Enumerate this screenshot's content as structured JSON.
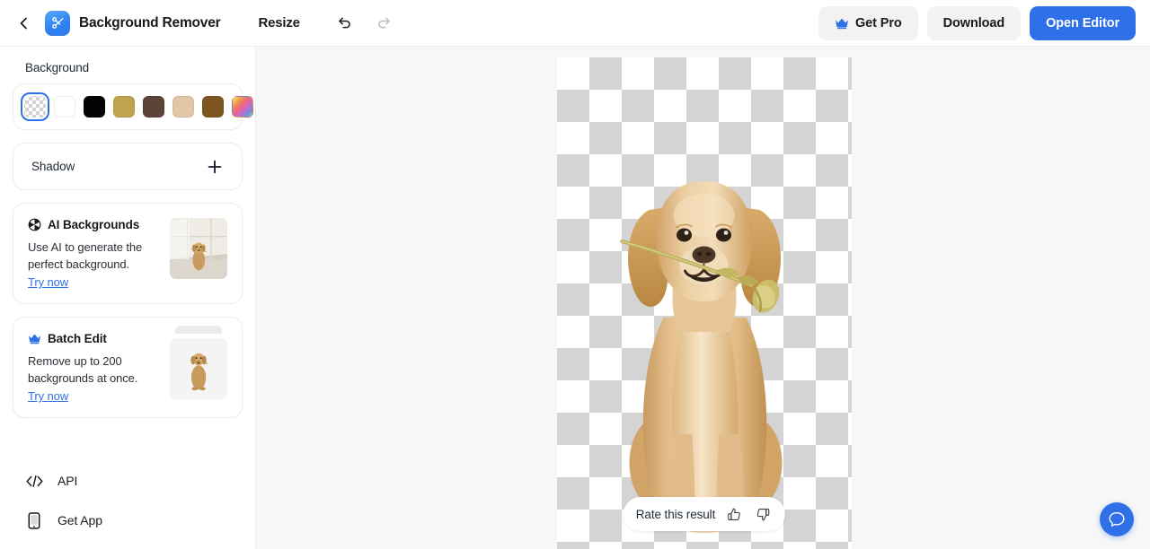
{
  "topbar": {
    "back_icon": "chevron-left-icon",
    "logo_icon": "scissors-icon",
    "title": "Background Remover",
    "resize_label": "Resize",
    "undo_icon": "undo-arrow-icon",
    "redo_icon": "redo-arrow-icon",
    "get_pro_label": "Get Pro",
    "get_pro_icon": "crown-icon",
    "download_label": "Download",
    "open_editor_label": "Open Editor",
    "primary_color": "#2f6fe8",
    "ghost_color": "#f2f2f3"
  },
  "sidebar": {
    "background_section": {
      "title": "Background",
      "swatches": [
        {
          "name": "transparent",
          "color": "transparent",
          "selected": true
        },
        {
          "name": "white",
          "color": "#ffffff",
          "selected": false
        },
        {
          "name": "black",
          "color": "#020202",
          "selected": false
        },
        {
          "name": "khaki",
          "color": "#bfa44f",
          "selected": false
        },
        {
          "name": "dark-brown",
          "color": "#5c4438",
          "selected": false
        },
        {
          "name": "tan",
          "color": "#e2c6a7",
          "selected": false
        },
        {
          "name": "brown",
          "color": "#7d5521",
          "selected": false
        },
        {
          "name": "gradient",
          "color": "rainbow",
          "selected": false
        }
      ]
    },
    "shadow_section": {
      "label": "Shadow",
      "add_icon": "plus-icon"
    },
    "promos": [
      {
        "icon": "sparkle-icon",
        "title": "AI Backgrounds",
        "description": "Use AI to generate the perfect background.",
        "link": "Try now",
        "thumb": "dog-in-room-thumbnail"
      },
      {
        "icon": "crown-icon",
        "title": "Batch Edit",
        "description": "Remove up to 200 backgrounds at once.",
        "link": "Try now",
        "thumb": "stacked-dog-thumbnail"
      }
    ],
    "bottom_links": [
      {
        "icon": "code-icon",
        "label": "API"
      },
      {
        "icon": "phone-icon",
        "label": "Get App"
      }
    ]
  },
  "canvas": {
    "checker_light": "#ffffff",
    "checker_dark": "#d4d4d4",
    "background": "#f7f7f7",
    "subject": "golden-retriever-puppy-with-flower",
    "rate": {
      "label": "Rate this result",
      "thumbs_up_icon": "thumbs-up-icon",
      "thumbs_down_icon": "thumbs-down-icon"
    }
  },
  "help": {
    "icon": "chat-bubble-icon",
    "color": "#2f6fe8"
  }
}
